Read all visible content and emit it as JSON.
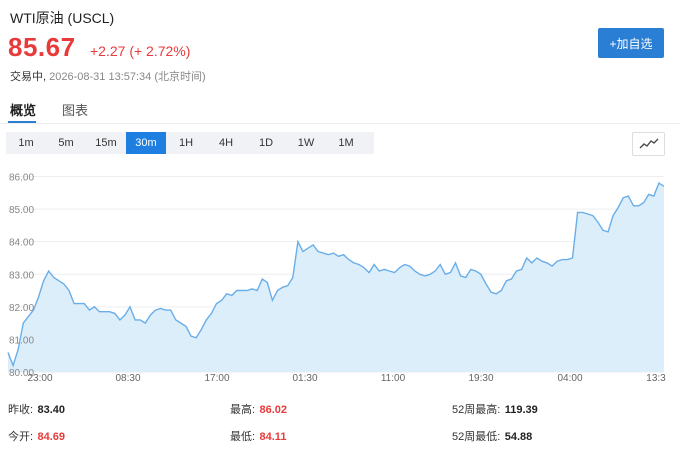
{
  "header": {
    "title": "WTI原油  (USCL)",
    "price": "85.67",
    "change": "+2.27 (+ 2.72%)",
    "status": "交易中,",
    "datetime": "2026-08-31 13:57:34 (北京时间)",
    "add_label": "+加自选"
  },
  "tabs": [
    {
      "label": "概览",
      "active": true
    },
    {
      "label": "图表",
      "active": false
    }
  ],
  "intervals": [
    {
      "label": "1m",
      "active": false
    },
    {
      "label": "5m",
      "active": false
    },
    {
      "label": "15m",
      "active": false
    },
    {
      "label": "30m",
      "active": true
    },
    {
      "label": "1H",
      "active": false
    },
    {
      "label": "4H",
      "active": false
    },
    {
      "label": "1D",
      "active": false
    },
    {
      "label": "1W",
      "active": false
    },
    {
      "label": "1M",
      "active": false
    }
  ],
  "chart_type_icon": "line-chart-icon",
  "colors": {
    "accent": "#1e7fe0",
    "up": "#e83a3a",
    "line": "#6aaee8",
    "fill": "#ddeefb"
  },
  "chart_data": {
    "type": "area",
    "ylim": [
      80,
      86.2
    ],
    "yticks": [
      "86.00",
      "85.00",
      "84.00",
      "83.00",
      "82.00",
      "81.00",
      "80.00"
    ],
    "xticks": [
      "23:00",
      "08:30",
      "17:00",
      "01:30",
      "11:00",
      "19:30",
      "04:00",
      "13:3"
    ],
    "values": [
      80.6,
      80.2,
      80.7,
      81.5,
      81.7,
      81.9,
      82.3,
      82.8,
      83.1,
      82.9,
      82.8,
      82.7,
      82.5,
      82.1,
      82.1,
      82.1,
      81.9,
      82.0,
      81.85,
      81.85,
      81.85,
      81.8,
      81.6,
      81.75,
      82.0,
      81.6,
      81.6,
      81.5,
      81.75,
      81.9,
      81.95,
      81.9,
      81.9,
      81.6,
      81.5,
      81.4,
      81.1,
      81.05,
      81.3,
      81.6,
      81.8,
      82.1,
      82.2,
      82.4,
      82.35,
      82.5,
      82.5,
      82.5,
      82.55,
      82.5,
      82.85,
      82.75,
      82.2,
      82.5,
      82.6,
      82.65,
      82.9,
      84.0,
      83.7,
      83.8,
      83.9,
      83.7,
      83.65,
      83.6,
      83.65,
      83.55,
      83.6,
      83.45,
      83.35,
      83.3,
      83.2,
      83.05,
      83.3,
      83.1,
      83.15,
      83.1,
      83.05,
      83.2,
      83.3,
      83.25,
      83.1,
      83.0,
      82.95,
      83.0,
      83.1,
      83.3,
      83.0,
      83.05,
      83.35,
      82.95,
      82.9,
      83.15,
      83.1,
      83.0,
      82.7,
      82.45,
      82.4,
      82.5,
      82.8,
      82.85,
      83.1,
      83.15,
      83.5,
      83.35,
      83.5,
      83.4,
      83.35,
      83.25,
      83.4,
      83.45,
      83.45,
      83.5,
      84.9,
      84.9,
      84.85,
      84.8,
      84.6,
      84.35,
      84.3,
      84.8,
      85.05,
      85.35,
      85.4,
      85.1,
      85.1,
      85.2,
      85.45,
      85.4,
      85.8,
      85.7
    ]
  },
  "stats": [
    [
      {
        "label": "昨收:",
        "value": "83.40",
        "color": "black"
      },
      {
        "label": "最高:",
        "value": "86.02",
        "color": "red"
      },
      {
        "label": "52周最高:",
        "value": "119.39",
        "color": "black"
      }
    ],
    [
      {
        "label": "今开:",
        "value": "84.69",
        "color": "red"
      },
      {
        "label": "最低:",
        "value": "84.11",
        "color": "red"
      },
      {
        "label": "52周最低:",
        "value": "54.88",
        "color": "black"
      }
    ]
  ]
}
